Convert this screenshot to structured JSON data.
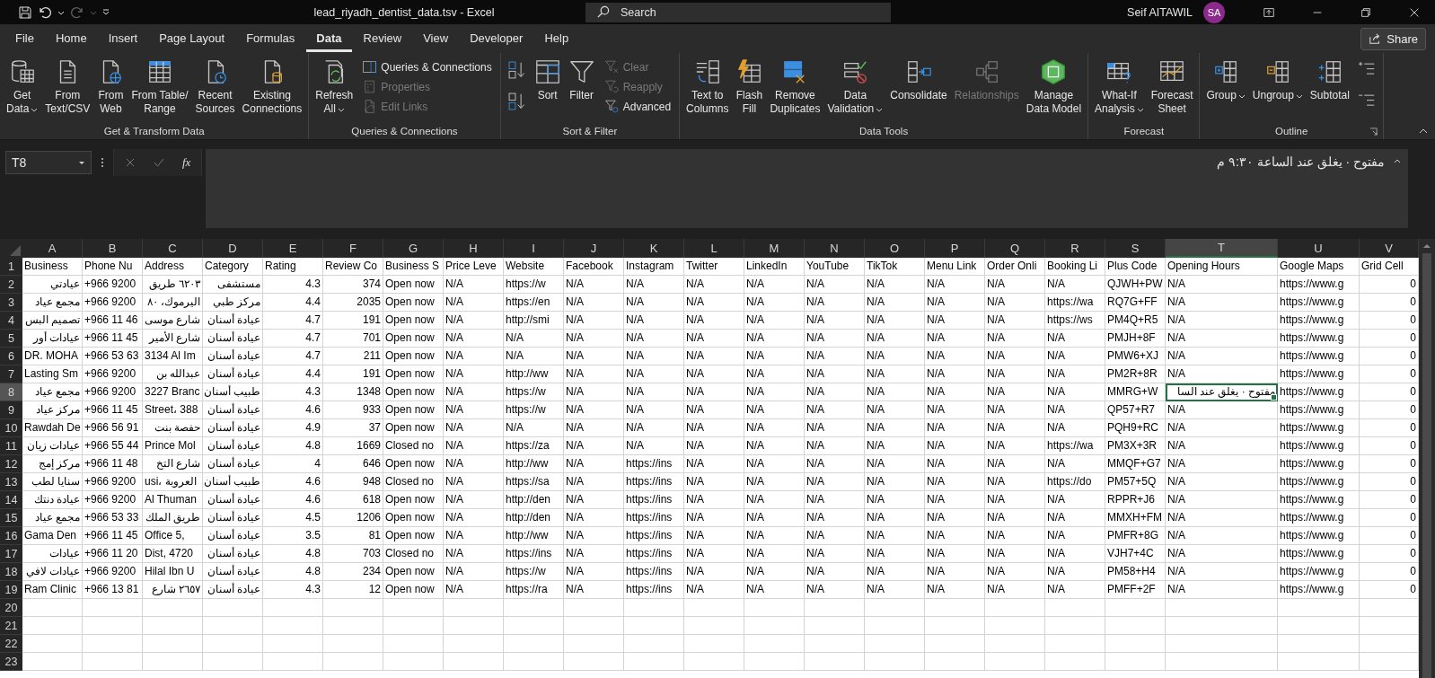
{
  "window": {
    "title": "lead_riyadh_dentist_data.tsv - Excel",
    "search": {
      "placeholder": "Search"
    },
    "user": {
      "name": "Seif AITAWIL",
      "initials": "SA"
    },
    "redo_disabled": true
  },
  "tabs": [
    {
      "label": "File",
      "selected": false
    },
    {
      "label": "Home",
      "selected": false
    },
    {
      "label": "Insert",
      "selected": false
    },
    {
      "label": "Page Layout",
      "selected": false
    },
    {
      "label": "Formulas",
      "selected": false
    },
    {
      "label": "Data",
      "selected": true
    },
    {
      "label": "Review",
      "selected": false
    },
    {
      "label": "View",
      "selected": false
    },
    {
      "label": "Developer",
      "selected": false
    },
    {
      "label": "Help",
      "selected": false
    }
  ],
  "share_button": "Share",
  "ribbon": {
    "groups": [
      {
        "label": "Get & Transform Data",
        "items": [
          {
            "kind": "large",
            "lines": [
              "Get",
              "Data"
            ],
            "dropdown": true,
            "disabled": false
          },
          {
            "kind": "large",
            "lines": [
              "From",
              "Text/CSV"
            ],
            "dropdown": false,
            "disabled": false
          },
          {
            "kind": "large",
            "lines": [
              "From",
              "Web"
            ],
            "dropdown": false,
            "disabled": false
          },
          {
            "kind": "large",
            "lines": [
              "From Table/",
              "Range"
            ],
            "dropdown": false,
            "disabled": false
          },
          {
            "kind": "large",
            "lines": [
              "Recent",
              "Sources"
            ],
            "dropdown": false,
            "disabled": false
          },
          {
            "kind": "large",
            "lines": [
              "Existing",
              "Connections"
            ],
            "dropdown": false,
            "disabled": false
          }
        ]
      },
      {
        "label": "Queries & Connections",
        "items": [
          {
            "kind": "large",
            "lines": [
              "Refresh",
              "All"
            ],
            "dropdown": true,
            "disabled": false
          },
          {
            "kind": "stack",
            "buttons": [
              {
                "label": "Queries & Connections",
                "disabled": false
              },
              {
                "label": "Properties",
                "disabled": true
              },
              {
                "label": "Edit Links",
                "disabled": true
              }
            ]
          }
        ]
      },
      {
        "label": "Sort & Filter",
        "items": [
          {
            "kind": "stack",
            "buttons": [
              {
                "disabled": false
              },
              {
                "disabled": false
              }
            ]
          },
          {
            "kind": "large",
            "lines": [
              "Sort"
            ],
            "dropdown": false,
            "disabled": false
          },
          {
            "kind": "large",
            "lines": [
              "Filter"
            ],
            "dropdown": false,
            "disabled": false
          },
          {
            "kind": "stack",
            "buttons": [
              {
                "label": "Clear",
                "disabled": true
              },
              {
                "label": "Reapply",
                "disabled": true
              },
              {
                "label": "Advanced",
                "disabled": false
              }
            ]
          }
        ]
      },
      {
        "label": "Data Tools",
        "items": [
          {
            "kind": "large",
            "lines": [
              "Text to",
              "Columns"
            ],
            "dropdown": false,
            "disabled": false
          },
          {
            "kind": "large",
            "lines": [
              "Flash",
              "Fill"
            ],
            "dropdown": false,
            "disabled": false
          },
          {
            "kind": "large",
            "lines": [
              "Remove",
              "Duplicates"
            ],
            "dropdown": false,
            "disabled": false
          },
          {
            "kind": "large",
            "lines": [
              "Data",
              "Validation"
            ],
            "dropdown": true,
            "disabled": false
          },
          {
            "kind": "large",
            "lines": [
              "Consolidate"
            ],
            "dropdown": false,
            "disabled": false
          },
          {
            "kind": "large",
            "lines": [
              "Relationships"
            ],
            "dropdown": false,
            "disabled": true
          },
          {
            "kind": "large",
            "lines": [
              "Manage",
              "Data Model"
            ],
            "dropdown": false,
            "disabled": false
          }
        ]
      },
      {
        "label": "Forecast",
        "items": [
          {
            "kind": "large",
            "lines": [
              "What-If",
              "Analysis"
            ],
            "dropdown": true,
            "disabled": false
          },
          {
            "kind": "large",
            "lines": [
              "Forecast",
              "Sheet"
            ],
            "dropdown": false,
            "disabled": false
          }
        ]
      },
      {
        "label": "Outline",
        "items": [
          {
            "kind": "large",
            "lines": [
              "Group"
            ],
            "dropdown": true,
            "disabled": false
          },
          {
            "kind": "large",
            "lines": [
              "Ungroup"
            ],
            "dropdown": true,
            "disabled": false
          },
          {
            "kind": "large",
            "lines": [
              "Subtotal"
            ],
            "dropdown": false,
            "disabled": false
          },
          {
            "kind": "stack",
            "buttons": [
              {
                "disabled": false
              },
              {
                "disabled": false
              }
            ]
          }
        ]
      }
    ]
  },
  "formula_bar": {
    "name_box": "T8",
    "function_label": "fx",
    "value": "مفتوح · يغلق عند الساعة ٩:٣٠ م"
  },
  "sheet": {
    "columns": [
      {
        "letter": "A",
        "kind": "text",
        "selected": false
      },
      {
        "letter": "B",
        "kind": "text",
        "selected": false
      },
      {
        "letter": "C",
        "kind": "text",
        "selected": false
      },
      {
        "letter": "D",
        "kind": "text",
        "selected": false
      },
      {
        "letter": "E",
        "kind": "number",
        "selected": false
      },
      {
        "letter": "F",
        "kind": "number",
        "selected": false
      },
      {
        "letter": "G",
        "kind": "text",
        "selected": false
      },
      {
        "letter": "H",
        "kind": "text",
        "selected": false
      },
      {
        "letter": "I",
        "kind": "text",
        "selected": false
      },
      {
        "letter": "J",
        "kind": "text",
        "selected": false
      },
      {
        "letter": "K",
        "kind": "text",
        "selected": false
      },
      {
        "letter": "L",
        "kind": "text",
        "selected": false
      },
      {
        "letter": "M",
        "kind": "text",
        "selected": false
      },
      {
        "letter": "N",
        "kind": "text",
        "selected": false
      },
      {
        "letter": "O",
        "kind": "text",
        "selected": false
      },
      {
        "letter": "P",
        "kind": "text",
        "selected": false
      },
      {
        "letter": "Q",
        "kind": "text",
        "selected": false
      },
      {
        "letter": "R",
        "kind": "text",
        "selected": false
      },
      {
        "letter": "S",
        "kind": "text",
        "selected": false
      },
      {
        "letter": "T",
        "kind": "text",
        "selected": true
      },
      {
        "letter": "U",
        "kind": "text",
        "selected": false
      },
      {
        "letter": "V",
        "kind": "number",
        "selected": false
      }
    ],
    "header_row": {
      "number": "1",
      "selected": false,
      "cells": [
        "Business",
        "Phone Nu",
        "Address",
        "Category",
        "Rating",
        "Review Co",
        "Business S",
        "Price Leve",
        "Website",
        "Facebook",
        "Instagram",
        "Twitter",
        "LinkedIn",
        "YouTube",
        "TikTok",
        "Menu Link",
        "Order Onli",
        "Booking Li",
        "Plus Code",
        "Opening Hours",
        "Google Maps",
        "Grid Cell"
      ]
    },
    "rows": [
      {
        "number": "2",
        "selected": false,
        "cells": [
          "عيادتي",
          "+966 9200",
          "٦٢٠٣ طريق",
          "مستشفى",
          "4.3",
          "374",
          "Open now",
          "N/A",
          "https://w",
          "N/A",
          "N/A",
          "N/A",
          "N/A",
          "N/A",
          "N/A",
          "N/A",
          "N/A",
          "N/A",
          "QJWH+PW",
          "N/A",
          "https://www.g",
          "0"
        ]
      },
      {
        "number": "3",
        "selected": false,
        "cells": [
          "مجمع عياد",
          "+966 9200",
          "اليرموك، ٨٠",
          "مركز طبي",
          "4.4",
          "2035",
          "Open now",
          "N/A",
          "https://en",
          "N/A",
          "N/A",
          "N/A",
          "N/A",
          "N/A",
          "N/A",
          "N/A",
          "N/A",
          "https://wa",
          "RQ7G+FF",
          "N/A",
          "https://www.g",
          "0"
        ]
      },
      {
        "number": "4",
        "selected": false,
        "cells": [
          "تصميم البس",
          "+966 11 46",
          "شارع موسى",
          "عيادة أسنان",
          "4.7",
          "191",
          "Open now",
          "N/A",
          "http://smi",
          "N/A",
          "N/A",
          "N/A",
          "N/A",
          "N/A",
          "N/A",
          "N/A",
          "N/A",
          "https://ws",
          "PM4Q+R5",
          "N/A",
          "https://www.g",
          "0"
        ]
      },
      {
        "number": "5",
        "selected": false,
        "cells": [
          "عيادات أور",
          "+966 11 45",
          "شارع الأمير",
          "عيادة أسنان",
          "4.7",
          "701",
          "Open now",
          "N/A",
          "N/A",
          "N/A",
          "N/A",
          "N/A",
          "N/A",
          "N/A",
          "N/A",
          "N/A",
          "N/A",
          "N/A",
          "PMJH+8F",
          "N/A",
          "https://www.g",
          "0"
        ]
      },
      {
        "number": "6",
        "selected": false,
        "cells": [
          "DR. MOHA",
          "+966 53 63",
          "3134 Al Im",
          "عيادة أسنان",
          "4.7",
          "211",
          "Open now",
          "N/A",
          "N/A",
          "N/A",
          "N/A",
          "N/A",
          "N/A",
          "N/A",
          "N/A",
          "N/A",
          "N/A",
          "N/A",
          "PMW6+XJ",
          "N/A",
          "https://www.g",
          "0"
        ]
      },
      {
        "number": "7",
        "selected": false,
        "cells": [
          "Lasting Sm",
          "+966 9200",
          "عبدالله بن",
          "عيادة أسنان",
          "4.4",
          "191",
          "Open now",
          "N/A",
          "http://ww",
          "N/A",
          "N/A",
          "N/A",
          "N/A",
          "N/A",
          "N/A",
          "N/A",
          "N/A",
          "N/A",
          "PM2R+8R",
          "N/A",
          "https://www.g",
          "0"
        ]
      },
      {
        "number": "8",
        "selected": true,
        "cells": [
          "مجمع عياد",
          "+966 9200",
          "3227 Branc",
          "طبيب أسنان",
          "4.3",
          "1348",
          "Open now",
          "N/A",
          "https://w",
          "N/A",
          "N/A",
          "N/A",
          "N/A",
          "N/A",
          "N/A",
          "N/A",
          "N/A",
          "N/A",
          "MMRG+W",
          "مفتوح · يغلق عند السا",
          "https://www.g",
          "0"
        ]
      },
      {
        "number": "9",
        "selected": false,
        "cells": [
          "مركز عياد",
          "+966 11 45",
          "Street، 388",
          "عيادة أسنان",
          "4.6",
          "933",
          "Open now",
          "N/A",
          "https://w",
          "N/A",
          "N/A",
          "N/A",
          "N/A",
          "N/A",
          "N/A",
          "N/A",
          "N/A",
          "N/A",
          "QP57+R7",
          "N/A",
          "https://www.g",
          "0"
        ]
      },
      {
        "number": "10",
        "selected": false,
        "cells": [
          "Rawdah De",
          "+966 56 91",
          "حفصة بنت",
          "عيادة أسنان",
          "4.9",
          "37",
          "Open now",
          "N/A",
          "N/A",
          "N/A",
          "N/A",
          "N/A",
          "N/A",
          "N/A",
          "N/A",
          "N/A",
          "N/A",
          "N/A",
          "PQH9+RC",
          "N/A",
          "https://www.g",
          "0"
        ]
      },
      {
        "number": "11",
        "selected": false,
        "cells": [
          "عيادات زيان",
          "+966 55 44",
          "Prince Mol",
          "عيادة أسنان",
          "4.8",
          "1669",
          "Closed no",
          "N/A",
          "https://za",
          "N/A",
          "N/A",
          "N/A",
          "N/A",
          "N/A",
          "N/A",
          "N/A",
          "N/A",
          "https://wa",
          "PM3X+3R",
          "N/A",
          "https://www.g",
          "0"
        ]
      },
      {
        "number": "12",
        "selected": false,
        "cells": [
          "مركز إمج",
          "+966 11 48",
          "شارع التخ",
          "عيادة أسنان",
          "4",
          "646",
          "Open now",
          "N/A",
          "http://ww",
          "N/A",
          "https://ins",
          "N/A",
          "N/A",
          "N/A",
          "N/A",
          "N/A",
          "N/A",
          "N/A",
          "MMQF+G7",
          "N/A",
          "https://www.g",
          "0"
        ]
      },
      {
        "number": "13",
        "selected": false,
        "cells": [
          "سنايا لطب",
          "+966 9200",
          "usi، العروبة",
          "طبيب أسنان",
          "4.6",
          "948",
          "Closed no",
          "N/A",
          "https://sa",
          "N/A",
          "https://ins",
          "N/A",
          "N/A",
          "N/A",
          "N/A",
          "N/A",
          "N/A",
          "https://do",
          "PM57+5Q",
          "N/A",
          "https://www.g",
          "0"
        ]
      },
      {
        "number": "14",
        "selected": false,
        "cells": [
          "عيادة دنتك",
          "+966 9200",
          "Al Thuman",
          "عيادة أسنان",
          "4.6",
          "618",
          "Open now",
          "N/A",
          "http://den",
          "N/A",
          "https://ins",
          "N/A",
          "N/A",
          "N/A",
          "N/A",
          "N/A",
          "N/A",
          "N/A",
          "RPPR+J6",
          "N/A",
          "https://www.g",
          "0"
        ]
      },
      {
        "number": "15",
        "selected": false,
        "cells": [
          "مجمع عياد",
          "+966 53 33",
          "طريق الملك",
          "عيادة أسنان",
          "4.5",
          "1206",
          "Open now",
          "N/A",
          "http://den",
          "N/A",
          "https://ins",
          "N/A",
          "N/A",
          "N/A",
          "N/A",
          "N/A",
          "N/A",
          "N/A",
          "MMXH+FM",
          "N/A",
          "https://www.g",
          "0"
        ]
      },
      {
        "number": "16",
        "selected": false,
        "cells": [
          "Gama Den",
          "+966 11 45",
          "Office 5,",
          "عيادة أسنان",
          "3.5",
          "81",
          "Open now",
          "N/A",
          "http://ww",
          "N/A",
          "https://ins",
          "N/A",
          "N/A",
          "N/A",
          "N/A",
          "N/A",
          "N/A",
          "N/A",
          "PMFR+8G",
          "N/A",
          "https://www.g",
          "0"
        ]
      },
      {
        "number": "17",
        "selected": false,
        "cells": [
          "عيادات",
          "+966 11 20",
          "Dist, 4720",
          "عيادة أسنان",
          "4.8",
          "703",
          "Closed no",
          "N/A",
          "https://ins",
          "N/A",
          "https://ins",
          "N/A",
          "N/A",
          "N/A",
          "N/A",
          "N/A",
          "N/A",
          "N/A",
          "VJH7+4C",
          "N/A",
          "https://www.g",
          "0"
        ]
      },
      {
        "number": "18",
        "selected": false,
        "cells": [
          "عيادات لافي",
          "+966 9200",
          "Hilal Ibn U",
          "عيادة أسنان",
          "4.8",
          "234",
          "Open now",
          "N/A",
          "https://w",
          "N/A",
          "https://ins",
          "N/A",
          "N/A",
          "N/A",
          "N/A",
          "N/A",
          "N/A",
          "N/A",
          "PM58+H4",
          "N/A",
          "https://www.g",
          "0"
        ]
      },
      {
        "number": "19",
        "selected": false,
        "cells": [
          "Ram Clinic",
          "+966 13 81",
          "٢٦٥٧ شارع",
          "عيادة أسنان",
          "4.3",
          "12",
          "Open now",
          "N/A",
          "https://ra",
          "N/A",
          "https://ins",
          "N/A",
          "N/A",
          "N/A",
          "N/A",
          "N/A",
          "N/A",
          "N/A",
          "PMFF+2F",
          "N/A",
          "https://www.g",
          "0"
        ]
      },
      {
        "number": "20",
        "selected": false
      },
      {
        "number": "21",
        "selected": false
      },
      {
        "number": "22",
        "selected": false
      },
      {
        "number": "23",
        "selected": false
      }
    ]
  }
}
